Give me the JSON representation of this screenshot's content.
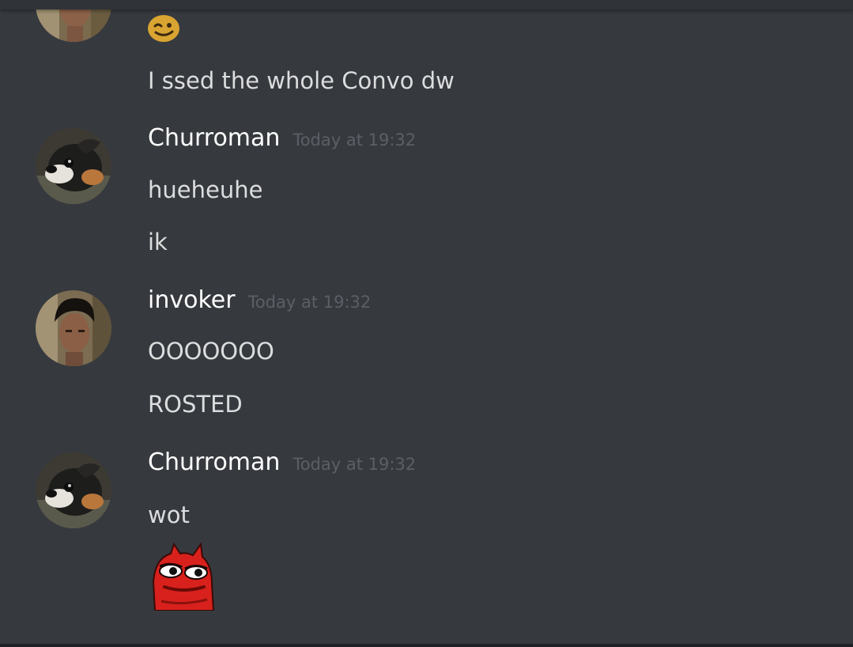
{
  "messages": [
    {
      "avatar_icon": "guy-photo-avatar",
      "lines": [
        "",
        "I ssed the whole Convo dw"
      ],
      "emoji": "winking-face-icon"
    },
    {
      "author": "Churroman",
      "timestamp": "Today at 19:32",
      "avatar_icon": "dog-photo-avatar",
      "lines": [
        "hueheuhe",
        "ik"
      ]
    },
    {
      "author": "invoker",
      "timestamp": "Today at 19:32",
      "avatar_icon": "guy-photo-avatar",
      "lines": [
        "OOOOOOO",
        "ROSTED"
      ]
    },
    {
      "author": "Churroman",
      "timestamp": "Today at 19:32",
      "avatar_icon": "dog-photo-avatar",
      "lines": [
        "wot"
      ],
      "emoji": "red-pepe-devil-emoji"
    }
  ],
  "colors": {
    "background": "#36393e",
    "text": "#dcddde",
    "username": "#ffffff",
    "timestamp": "#5c5f66"
  }
}
